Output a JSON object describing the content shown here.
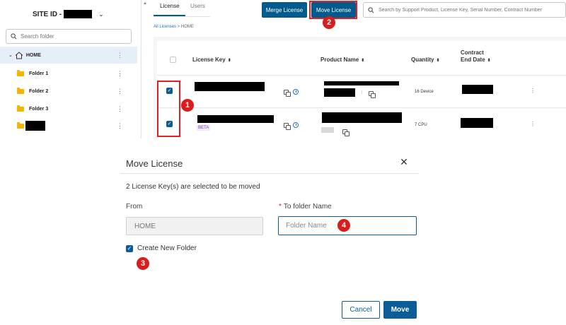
{
  "sidebar": {
    "site_label": "SITE ID -",
    "search_placeholder": "Search folder",
    "items": [
      {
        "label": "HOME"
      },
      {
        "label": "Folder 1"
      },
      {
        "label": "Folder 2"
      },
      {
        "label": "Folder 3"
      }
    ]
  },
  "tabs": [
    "License",
    "Users"
  ],
  "toolbar": {
    "merge_label": "Merge License",
    "move_label": "Move License",
    "search_placeholder": "Search by Support Product, License Key, Serial Number, Contract Number"
  },
  "breadcrumb": {
    "link": "All Licenses",
    "separator": " > ",
    "current": "HOME"
  },
  "table": {
    "headers": [
      "License Key",
      "Product Name",
      "Quantity",
      "Contract End Date"
    ],
    "rows": [
      {
        "quantity": "16 Device",
        "badge": ""
      },
      {
        "quantity": "7 CPU",
        "badge": "BETA"
      }
    ]
  },
  "annotations": [
    "1",
    "2",
    "3",
    "4"
  ],
  "dialog": {
    "title": "Move License",
    "message": "2 License Key(s) are selected to be moved",
    "from_label": "From",
    "from_value": "HOME",
    "to_required": "*",
    "to_label": "To folder Name",
    "to_placeholder": "Folder Name",
    "create_label": "Create New Folder",
    "cancel_label": "Cancel",
    "move_label": "Move"
  },
  "colors": {
    "primary": "#005a8c",
    "highlight": "#e31e24",
    "folder": "#f5b400"
  }
}
